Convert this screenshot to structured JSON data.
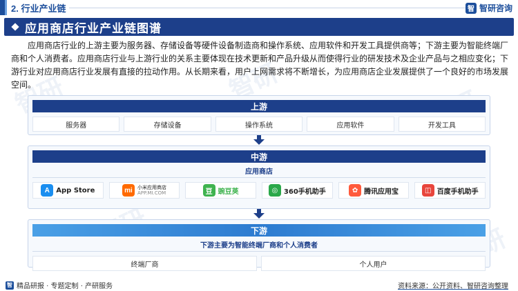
{
  "header": {
    "section_title": "2. 行业产业链",
    "brand": "智研咨询"
  },
  "banner": {
    "title": "应用商店行业产业链图谱"
  },
  "intro": "应用商店行业的上游主要为服务器、存储设备等硬件设备制造商和操作系统、应用软件和开发工具提供商等；下游主要为智能终端厂商和个人消费者。应用商店行业与上游行业的关系主要体现在技术更新和产品升级从而使得行业的研发技术及企业产品与之相应变化；下游行业对应用商店行业发展有直接的拉动作用。从长期来看，用户上网需求将不断增长，为应用商店企业发展提供了一个良好的市场发展空间。",
  "upstream": {
    "title": "上游",
    "items": [
      "服务器",
      "存储设备",
      "操作系统",
      "应用软件",
      "开发工具"
    ]
  },
  "midstream": {
    "title": "中游",
    "label": "应用商店",
    "apps": [
      {
        "name": "App Store",
        "icon": "app-store-icon",
        "color": "#1a8ef0",
        "glyph": "A"
      },
      {
        "name": "小米应用商店",
        "sub": "APP.MI.COM",
        "icon": "xiaomi-icon",
        "color": "#ff6a00",
        "glyph": "mi"
      },
      {
        "name": "豌豆荚",
        "icon": "wandoujia-icon",
        "color": "#3fb34f",
        "glyph": "豆"
      },
      {
        "name": "360手机助手",
        "icon": "360-icon",
        "color": "#2aa84a",
        "glyph": "◎"
      },
      {
        "name": "腾讯应用宝",
        "icon": "tencent-icon",
        "color": "#ff5a3c",
        "glyph": "✿"
      },
      {
        "name": "百度手机助手",
        "icon": "baidu-icon",
        "color": "#e8453c",
        "glyph": "◫"
      }
    ]
  },
  "downstream": {
    "title": "下游",
    "label": "下游主要为智能终端厂商和个人消费者",
    "items": [
      "终端厂商",
      "个人用户"
    ]
  },
  "footer": {
    "left": "精品研报 · 专题定制 · 产研服务",
    "source": "资料来源：公开资料、智研咨询整理"
  },
  "colors": {
    "primary": "#1d3f8a",
    "accent": "#2d7bd0"
  }
}
